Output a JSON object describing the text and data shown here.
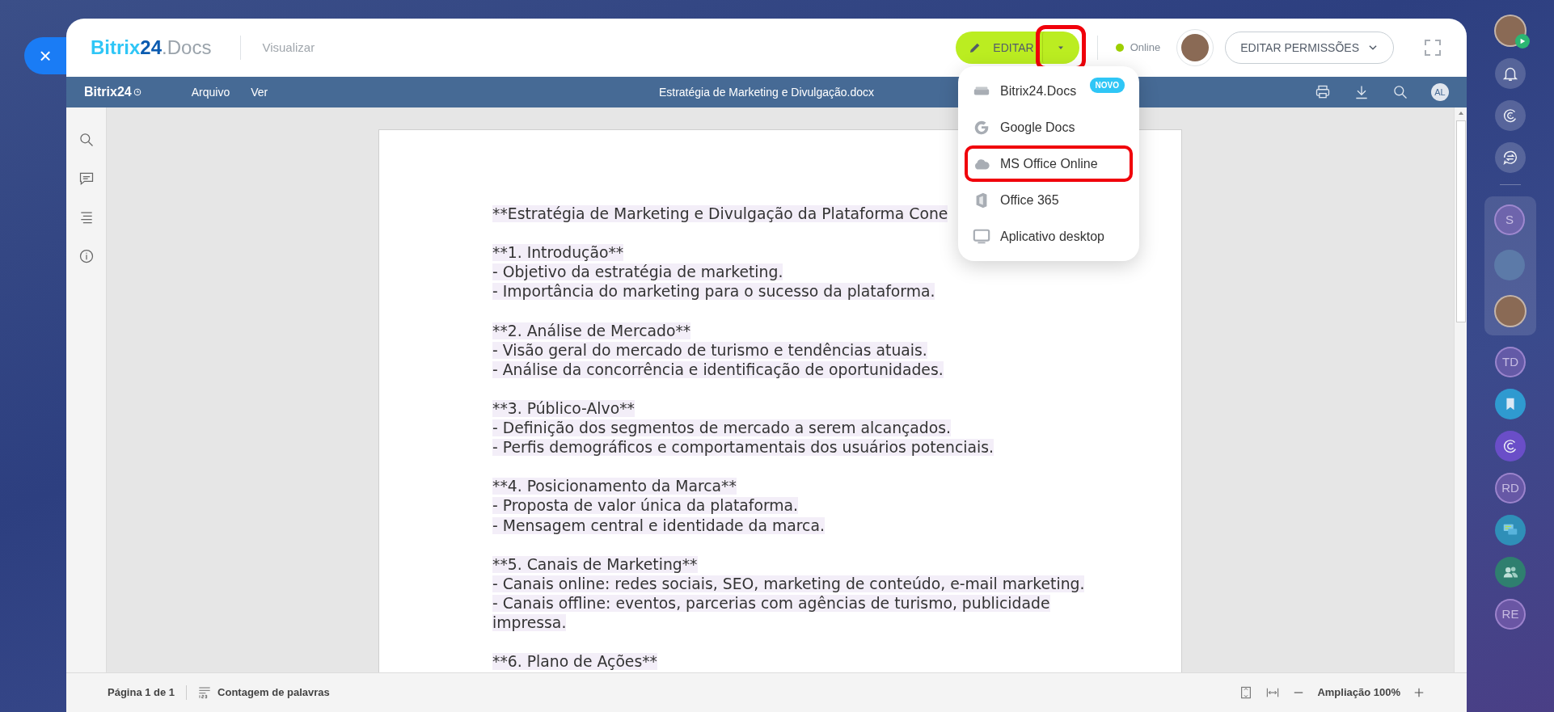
{
  "close_button": "×",
  "header": {
    "logo": {
      "brand": "Bitrix",
      "number": "24",
      "product": ".Docs"
    },
    "mode": "Visualizar",
    "edit_button": {
      "label": "EDITAR",
      "caret_highlighted": true
    },
    "status": {
      "label": "Online",
      "online": true
    },
    "permissions_button": "EDITAR PERMISSÕES"
  },
  "edit_menu": {
    "expanded": true,
    "items": [
      {
        "kind": "drive",
        "label": "Bitrix24.Docs",
        "badge": "NOVO",
        "highlighted": false
      },
      {
        "kind": "google",
        "label": "Google Docs",
        "highlighted": false
      },
      {
        "kind": "cloud",
        "label": "MS Office Online",
        "highlighted": true
      },
      {
        "kind": "office",
        "label": "Office 365",
        "highlighted": false
      },
      {
        "kind": "monitor",
        "label": "Aplicativo desktop",
        "highlighted": false
      }
    ]
  },
  "toolbar": {
    "logo": "Bitrix24",
    "menus": [
      "Arquivo",
      "Ver"
    ],
    "file_name": "Estratégia de Marketing e Divulgação.docx",
    "user_initials": "AL"
  },
  "document": {
    "paragraphs": [
      [
        "**Estratégia de Marketing e Divulgação da Plataforma Cone"
      ],
      [
        "**1. Introdução**",
        "- Objetivo da estratégia de marketing.",
        "- Importância do marketing para o sucesso da plataforma."
      ],
      [
        "**2. Análise de Mercado**",
        "- Visão geral do mercado de turismo e tendências atuais.",
        "- Análise da concorrência e identificação de oportunidades."
      ],
      [
        "**3. Público-Alvo**",
        "- Definição dos segmentos de mercado a serem alcançados.",
        "- Perfis demográficos e comportamentais dos usuários potenciais."
      ],
      [
        "**4. Posicionamento da Marca**",
        "- Proposta de valor única da plataforma.",
        "- Mensagem central e identidade da marca."
      ],
      [
        "**5. Canais de Marketing**",
        "- Canais online: redes sociais, SEO, marketing de conteúdo, e-mail marketing.",
        "- Canais offline: eventos, parcerias com agências de turismo, publicidade",
        "impressa."
      ],
      [
        "**6. Plano de Ações**"
      ]
    ]
  },
  "status_bar": {
    "page": "Página 1 de 1",
    "word_count": "Contagem de palavras",
    "zoom": "Ampliação 100%"
  },
  "right_sidebar": {
    "items": [
      {
        "kind": "user",
        "online": true
      },
      {
        "kind": "bell"
      },
      {
        "kind": "copilot"
      },
      {
        "kind": "sync"
      },
      {
        "kind": "divider"
      },
      {
        "kind": "group",
        "children": [
          {
            "kind": "initials",
            "text": "S"
          },
          {
            "kind": "photo"
          },
          {
            "kind": "user",
            "online": false
          }
        ]
      },
      {
        "kind": "initials",
        "text": "TD"
      },
      {
        "kind": "bookmark"
      },
      {
        "kind": "copilot-chat"
      },
      {
        "kind": "initials",
        "text": "RD"
      },
      {
        "kind": "chat"
      },
      {
        "kind": "people"
      },
      {
        "kind": "initials",
        "text": "RE"
      }
    ]
  }
}
